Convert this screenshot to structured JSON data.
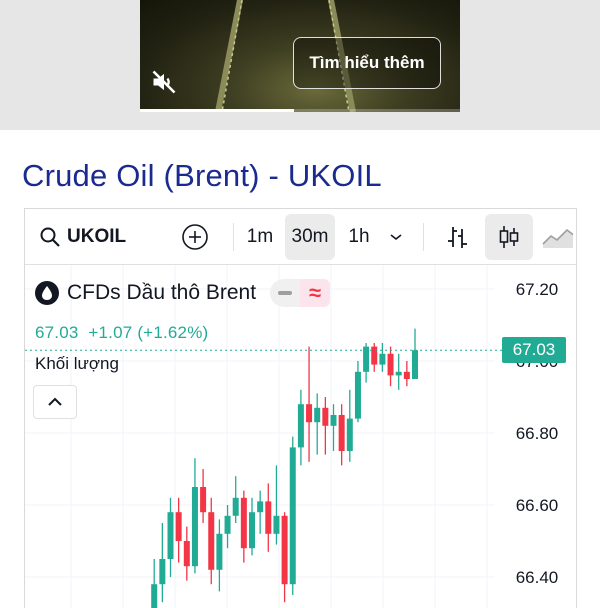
{
  "video": {
    "learn_more_label": "Tìm hiểu thêm",
    "mute_icon": "speaker-muted-icon",
    "progress_fraction": 0.48
  },
  "page": {
    "title": "Crude Oil (Brent) - UKOIL"
  },
  "toolbar": {
    "symbol": "UKOIL",
    "search_icon": "search-icon",
    "add_icon": "plus-circle-icon",
    "intervals": [
      "1m",
      "30m",
      "1h"
    ],
    "active_interval": "30m",
    "interval_dropdown_icon": "chevron-down-icon",
    "indicators_icon": "bar-chart-style-icon",
    "candles_icon": "candlestick-style-icon",
    "area_icon": "area-chart-style-icon"
  },
  "legend": {
    "name": "CFDs Dầu thô Brent",
    "change_text": "67.03  +1.07 (+1.62%)",
    "volume_label": "Khối lượng"
  },
  "colors": {
    "up": "#22ab94",
    "down": "#f23645",
    "title": "#1b2a8e"
  },
  "chart_data": {
    "type": "candlestick",
    "last_price": "67.03",
    "y_ticks": [
      "67.20",
      "67.00",
      "66.80",
      "66.60",
      "66.40"
    ],
    "ylim": [
      66.34,
      67.25
    ],
    "candles": [
      {
        "o": 66.3,
        "c": 66.38,
        "h": 66.45,
        "l": 66.25
      },
      {
        "o": 66.38,
        "c": 66.45,
        "h": 66.55,
        "l": 66.33
      },
      {
        "o": 66.45,
        "c": 66.58,
        "h": 66.62,
        "l": 66.4
      },
      {
        "o": 66.58,
        "c": 66.5,
        "h": 66.62,
        "l": 66.44
      },
      {
        "o": 66.5,
        "c": 66.43,
        "h": 66.54,
        "l": 66.39
      },
      {
        "o": 66.43,
        "c": 66.65,
        "h": 66.73,
        "l": 66.41
      },
      {
        "o": 66.65,
        "c": 66.58,
        "h": 66.7,
        "l": 66.55
      },
      {
        "o": 66.58,
        "c": 66.42,
        "h": 66.62,
        "l": 66.38
      },
      {
        "o": 66.42,
        "c": 66.52,
        "h": 66.56,
        "l": 66.36
      },
      {
        "o": 66.52,
        "c": 66.57,
        "h": 66.6,
        "l": 66.48
      },
      {
        "o": 66.57,
        "c": 66.62,
        "h": 66.68,
        "l": 66.55
      },
      {
        "o": 66.62,
        "c": 66.48,
        "h": 66.64,
        "l": 66.44
      },
      {
        "o": 66.48,
        "c": 66.58,
        "h": 66.62,
        "l": 66.46
      },
      {
        "o": 66.58,
        "c": 66.61,
        "h": 66.64,
        "l": 66.52
      },
      {
        "o": 66.61,
        "c": 66.52,
        "h": 66.66,
        "l": 66.47
      },
      {
        "o": 66.52,
        "c": 66.57,
        "h": 66.71,
        "l": 66.49
      },
      {
        "o": 66.57,
        "c": 66.38,
        "h": 66.58,
        "l": 66.33
      },
      {
        "o": 66.38,
        "c": 66.76,
        "h": 66.79,
        "l": 66.35
      },
      {
        "o": 66.76,
        "c": 66.88,
        "h": 66.92,
        "l": 66.71
      },
      {
        "o": 66.88,
        "c": 66.83,
        "h": 67.04,
        "l": 66.72
      },
      {
        "o": 66.83,
        "c": 66.87,
        "h": 66.91,
        "l": 66.74
      },
      {
        "o": 66.87,
        "c": 66.82,
        "h": 66.9,
        "l": 66.74
      },
      {
        "o": 66.82,
        "c": 66.85,
        "h": 66.88,
        "l": 66.75
      },
      {
        "o": 66.85,
        "c": 66.75,
        "h": 66.88,
        "l": 66.71
      },
      {
        "o": 66.75,
        "c": 66.84,
        "h": 66.92,
        "l": 66.72
      },
      {
        "o": 66.84,
        "c": 66.97,
        "h": 67.0,
        "l": 66.83
      },
      {
        "o": 66.97,
        "c": 67.04,
        "h": 67.05,
        "l": 66.94
      },
      {
        "o": 67.04,
        "c": 66.99,
        "h": 67.05,
        "l": 66.97
      },
      {
        "o": 66.99,
        "c": 67.02,
        "h": 67.05,
        "l": 66.97
      },
      {
        "o": 67.02,
        "c": 66.96,
        "h": 67.04,
        "l": 66.93
      },
      {
        "o": 66.96,
        "c": 66.97,
        "h": 67.02,
        "l": 66.92
      },
      {
        "o": 66.97,
        "c": 66.95,
        "h": 67.0,
        "l": 66.93
      },
      {
        "o": 66.95,
        "c": 67.03,
        "h": 67.09,
        "l": 66.95
      }
    ]
  }
}
